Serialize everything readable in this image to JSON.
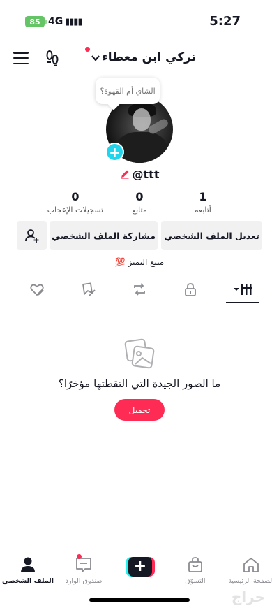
{
  "status_bar": {
    "battery": "85",
    "network": "4G",
    "signal": "▮▮▮▮",
    "time": "5:27"
  },
  "profile": {
    "username": "تركي ابن معطاء",
    "note": "الشاي أم القهوة؟",
    "handle": "@ttt",
    "stats": [
      {
        "value": "1",
        "label": "أتابعه"
      },
      {
        "value": "0",
        "label": "متابع"
      },
      {
        "value": "0",
        "label": "تسجيلات الإعجاب"
      }
    ],
    "buttons": {
      "edit": "تعديل الملف الشخصي",
      "share": "مشاركة الملف الشخصي"
    },
    "highlight": {
      "text": "منبع التميز",
      "emoji": "💯"
    }
  },
  "tabs": [
    {
      "icon": "grid-icon",
      "active": true
    },
    {
      "icon": "lock-icon",
      "active": false
    },
    {
      "icon": "repost-icon",
      "active": false
    },
    {
      "icon": "favorites-icon",
      "active": false
    },
    {
      "icon": "liked-icon",
      "active": false
    }
  ],
  "empty_state": {
    "title": "ما الصور الجيدة التي التقطتها مؤخرًا؟",
    "button": "تحميل"
  },
  "bottom_nav": [
    {
      "label": "الصفحة الرئيسية",
      "icon": "home-icon"
    },
    {
      "label": "التسوّق",
      "icon": "shop-icon"
    },
    {
      "label": "",
      "icon": "create-icon"
    },
    {
      "label": "صندوق الوارد",
      "icon": "inbox-icon"
    },
    {
      "label": "الملف الشخصي",
      "icon": "profile-icon",
      "active": true
    }
  ],
  "watermark": "حراج",
  "colors": {
    "accent": "#fe2c55",
    "cyan": "#20d5ec",
    "text": "#161823"
  }
}
